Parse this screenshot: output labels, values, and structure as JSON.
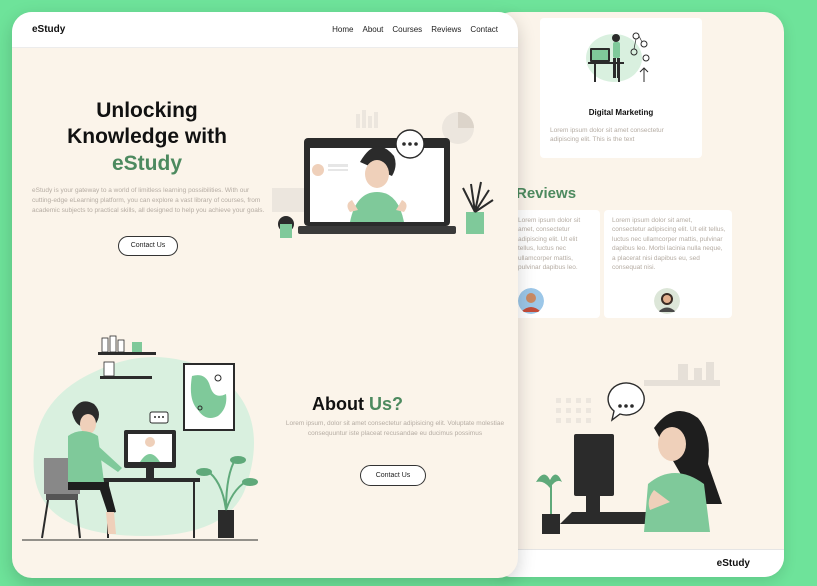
{
  "back_page": {
    "service_card": {
      "title": "Digital Marketing",
      "text": "Lorem ipsum dolor sit amet consectetur adipiscing elit. This is the text"
    },
    "reviews_heading": "Reviews",
    "reviews": [
      {
        "text": "Lorem ipsum dolor sit amet, consectetur adipiscing elit. Ut elit tellus, luctus nec ullamcorper mattis, pulvinar dapibus leo."
      },
      {
        "text": "Lorem ipsum dolor sit amet, consectetur adipiscing elit. Ut elit tellus, luctus nec ullamcorper mattis, pulvinar dapibus leo. Morbi lacinia nulla neque, a placerat nisi dapibus eu, sed consequat nisi."
      }
    ],
    "footer_logo": "eStudy"
  },
  "front_page": {
    "logo": "eStudy",
    "nav": [
      "Home",
      "About",
      "Courses",
      "Reviews",
      "Contact"
    ],
    "hero": {
      "title_line1": "Unlocking",
      "title_line2": "Knowledge with",
      "title_accent": "eStudy",
      "text": "eStudy is your gateway to a world of limitless learning possibilities. With our cutting-edge eLearning platform, you can explore a vast library of courses, from academic subjects to practical skills, all designed to help you achieve your goals.",
      "cta": "Contact Us"
    },
    "about": {
      "title_plain": "About",
      "title_accent": "Us?",
      "text": "Lorem ipsum, dolor sit amet consectetur adipisicing elit. Voluptate molestiae consequuntur iste placeat recusandae eu ducimus possimus",
      "cta": "Contact Us"
    }
  },
  "colors": {
    "background": "#6ee39a",
    "page": "#fbf4ea",
    "accent": "#4d8a5f",
    "illustration_green": "#7fc99a"
  }
}
